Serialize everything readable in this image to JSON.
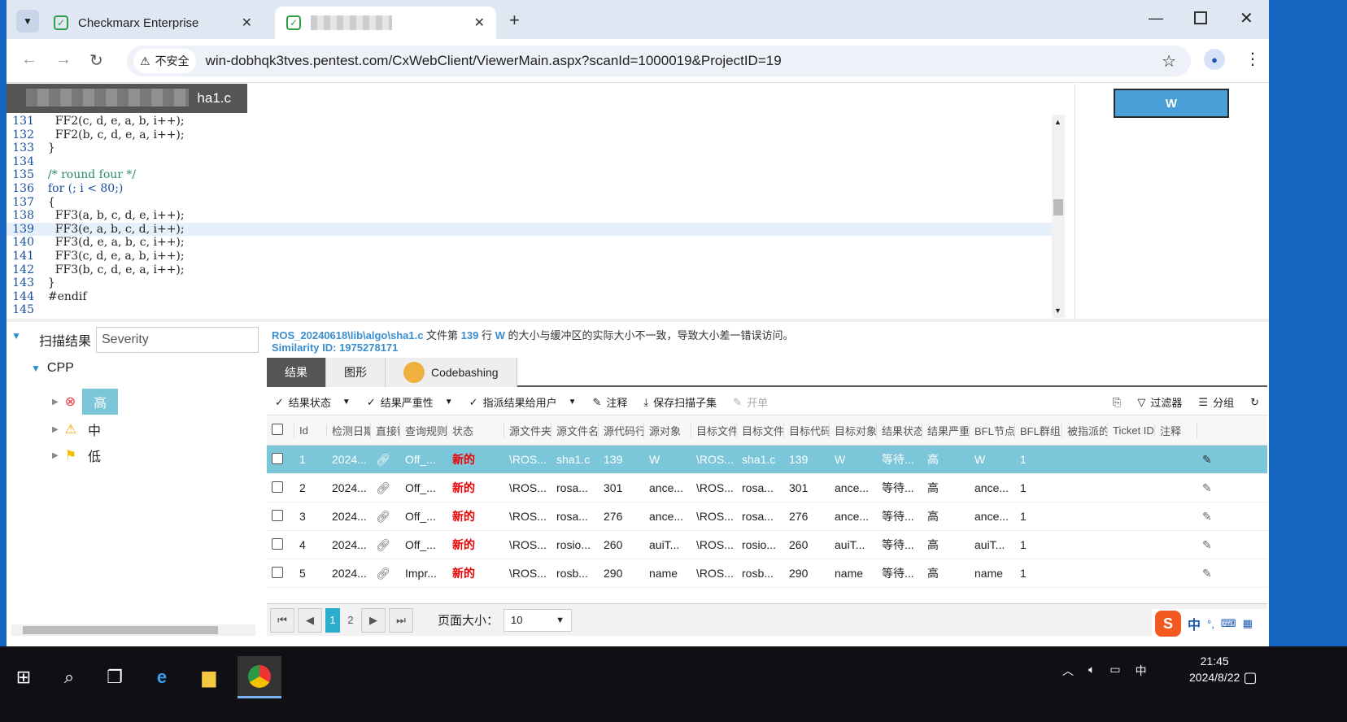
{
  "browser": {
    "tabs": [
      {
        "label": "Checkmarx Enterprise",
        "active": false
      },
      {
        "label": "",
        "active": true
      }
    ],
    "new_tab": "+",
    "security_label": "不安全",
    "url": "win-dobhqk3tves.pentest.com/CxWebClient/ViewerMain.aspx?scanId=1000019&ProjectID=19"
  },
  "editor": {
    "file_tab": "ha1.c",
    "lines": [
      {
        "n": "131",
        "t": "    FF2(c, d, e, a, b, i++);"
      },
      {
        "n": "132",
        "t": "    FF2(b, c, d, e, a, i++);"
      },
      {
        "n": "133",
        "t": "  }"
      },
      {
        "n": "134",
        "t": ""
      },
      {
        "n": "135",
        "t": "  /* round four */"
      },
      {
        "n": "136",
        "t": "  for (; i < 80;)"
      },
      {
        "n": "137",
        "t": "  {"
      },
      {
        "n": "138",
        "t": "    FF3(a, b, c, d, e, i++);"
      },
      {
        "n": "139",
        "t": "    FF3(e, a, b, c, d, i++);"
      },
      {
        "n": "140",
        "t": "    FF3(d, e, a, b, c, i++);"
      },
      {
        "n": "141",
        "t": "    FF3(c, d, e, a, b, i++);"
      },
      {
        "n": "142",
        "t": "    FF3(b, c, d, e, a, i++);"
      },
      {
        "n": "143",
        "t": "  }"
      },
      {
        "n": "144",
        "t": "  #endif"
      },
      {
        "n": "145",
        "t": ""
      }
    ],
    "highlighted_line": "139",
    "w_button": "W"
  },
  "left": {
    "title": "扫描结果",
    "severity_select": "Severity",
    "tree": {
      "root": "CPP",
      "items": [
        "高",
        "中",
        "低"
      ]
    }
  },
  "detail": {
    "path": "ROS_20240618\\lib\\algo\\sha1.c",
    "t1": " 文件第 ",
    "line": "139",
    "t2": " 行 ",
    "var": "W",
    "t3": " 的大小与缓冲区的实际大小不一致，导致大小差一错误访问。",
    "similarity": "Similarity ID: 1975278171"
  },
  "tabs": [
    "结果",
    "图形",
    "Codebashing"
  ],
  "actions": [
    "结果状态",
    "结果严重性",
    "指派结果给用户",
    "注释",
    "保存扫描子集",
    "开单",
    "过滤器",
    "分组"
  ],
  "grid": {
    "headers": [
      "Id",
      "检测日期",
      "直接链接",
      "查询规则",
      "状态",
      "源文件夹",
      "源文件名",
      "源代码行",
      "源对象",
      "目标文件夹",
      "目标文件名",
      "目标代码行",
      "目标对象",
      "结果状态",
      "结果严重性",
      "BFL节点",
      "BFL群组",
      "被指派的",
      "Ticket ID",
      "注释"
    ],
    "rows": [
      [
        "1",
        "2024...",
        "",
        "Off_...",
        "新的",
        "\\ROS...",
        "sha1.c",
        "139",
        "W",
        "\\ROS...",
        "sha1.c",
        "139",
        "W",
        "等待...",
        "高",
        "W",
        "1",
        "",
        "",
        ""
      ],
      [
        "2",
        "2024...",
        "",
        "Off_...",
        "新的",
        "\\ROS...",
        "rosa...",
        "301",
        "ance...",
        "\\ROS...",
        "rosa...",
        "301",
        "ance...",
        "等待...",
        "高",
        "ance...",
        "1",
        "",
        "",
        ""
      ],
      [
        "3",
        "2024...",
        "",
        "Off_...",
        "新的",
        "\\ROS...",
        "rosa...",
        "276",
        "ance...",
        "\\ROS...",
        "rosa...",
        "276",
        "ance...",
        "等待...",
        "高",
        "ance...",
        "1",
        "",
        "",
        ""
      ],
      [
        "4",
        "2024...",
        "",
        "Off_...",
        "新的",
        "\\ROS...",
        "rosio...",
        "260",
        "auiT...",
        "\\ROS...",
        "rosio...",
        "260",
        "auiT...",
        "等待...",
        "高",
        "auiT...",
        "1",
        "",
        "",
        ""
      ],
      [
        "5",
        "2024...",
        "",
        "Impr...",
        "新的",
        "\\ROS...",
        "rosb...",
        "290",
        "name",
        "\\ROS...",
        "rosb...",
        "290",
        "name",
        "等待...",
        "高",
        "name",
        "1",
        "",
        "",
        ""
      ]
    ]
  },
  "pager": {
    "pages": [
      "1",
      "2"
    ],
    "page_size_label": "页面大小：",
    "page_size": "10"
  },
  "ime": {
    "lang": "中"
  },
  "taskbar": {
    "time": "21:45",
    "date": "2024/8/22",
    "ime": "中"
  }
}
